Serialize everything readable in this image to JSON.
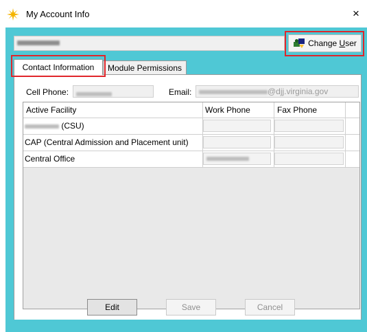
{
  "window": {
    "title": "My Account Info",
    "close_glyph": "×",
    "icon": "sun-icon"
  },
  "user": {
    "name_redacted": "",
    "change_user_label": "Change User",
    "change_user_icon": "user-switch-icon"
  },
  "tabs": [
    {
      "label": "Contact Information",
      "active": true
    },
    {
      "label": "Module Permissions",
      "active": false
    }
  ],
  "contact": {
    "cell_label": "Cell Phone:",
    "email_label": "Email:",
    "email_suffix": "@djj.virginia.gov"
  },
  "grid": {
    "columns": [
      "Active Facility",
      "Work Phone",
      "Fax Phone"
    ],
    "rows": [
      {
        "facility": "(CSU)",
        "facility_redacted_prefix": true
      },
      {
        "facility": "CAP (Central Admission and Placement unit)"
      },
      {
        "facility": "Central Office",
        "work_phone_redacted": true
      }
    ]
  },
  "buttons": {
    "edit": "Edit",
    "save": "Save",
    "cancel": "Cancel"
  },
  "colors": {
    "frame": "#4fc8d5",
    "highlight": "#e0252a",
    "title_icon": "#f4b400"
  }
}
